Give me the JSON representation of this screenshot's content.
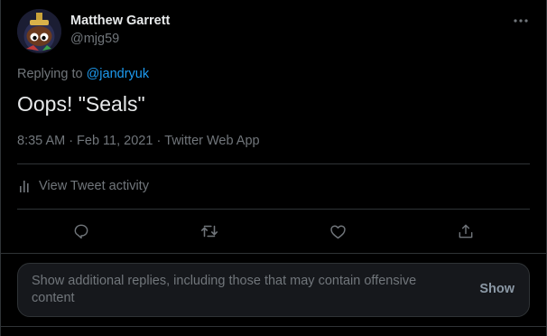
{
  "tweet": {
    "author_name": "Matthew Garrett",
    "author_handle": "@mjg59",
    "replying_prefix": "Replying to",
    "replying_to": "@jandryuk",
    "text": "Oops! \"Seals\"",
    "time": "8:35 AM",
    "date": "Feb 11, 2021",
    "source": "Twitter Web App",
    "separator": "·"
  },
  "activity": {
    "label": "View Tweet activity",
    "icon": "bar-chart-icon"
  },
  "actions": [
    {
      "name": "reply",
      "icon": "reply-icon"
    },
    {
      "name": "retweet",
      "icon": "retweet-icon"
    },
    {
      "name": "like",
      "icon": "heart-icon"
    },
    {
      "name": "share",
      "icon": "share-icon"
    }
  ],
  "notice": {
    "text": "Show additional replies, including those that may contain offensive content",
    "button": "Show"
  },
  "colors": {
    "background": "#000000",
    "text": "#e7e9ea",
    "muted": "#71767b",
    "accent": "#1d9bf0",
    "border": "#2f3336"
  }
}
